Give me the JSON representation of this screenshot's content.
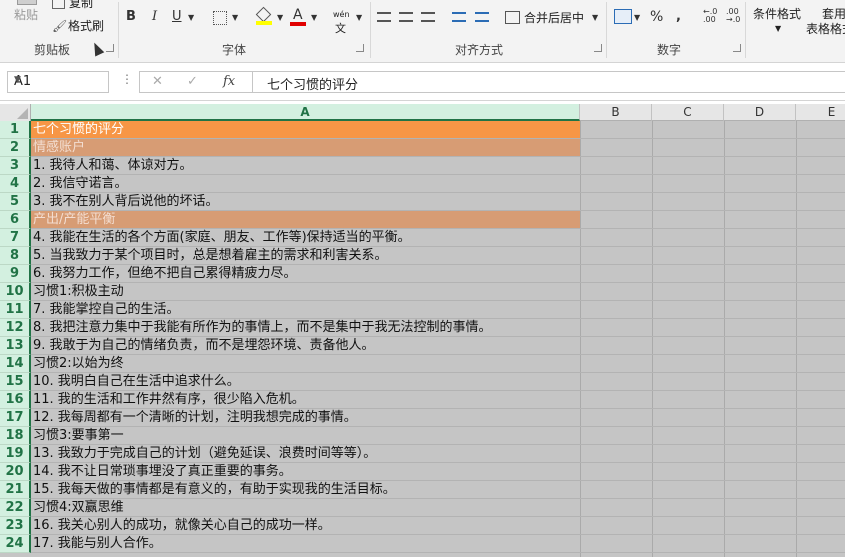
{
  "ribbon": {
    "clipboard": {
      "paste_label": "粘贴",
      "copy_label": "复制",
      "format_painter_label": "格式刷",
      "group_label": "剪贴板"
    },
    "font": {
      "bold": "B",
      "italic": "I",
      "underline": "U",
      "font_color_glyph": "A",
      "wen_glyph": "wén",
      "group_label": "字体"
    },
    "alignment": {
      "merge_center_label": "合并后居中",
      "group_label": "对齐方式"
    },
    "number": {
      "percent": "%",
      "comma": ",",
      "group_label": "数字"
    },
    "styles": {
      "conditional_format_label": "条件格式",
      "table_format_label_1": "套用",
      "table_format_label_2": "表格格式"
    }
  },
  "formula_bar": {
    "name_box": "A1",
    "cancel_glyph": "✕",
    "enter_glyph": "✓",
    "fx_glyph": "fx",
    "content": "七个习惯的评分"
  },
  "columns": [
    "A",
    "B",
    "C",
    "D",
    "E"
  ],
  "rows": [
    {
      "num": "1",
      "text": "七个习惯的评分",
      "style": "title"
    },
    {
      "num": "2",
      "text": "情感账户",
      "style": "section"
    },
    {
      "num": "3",
      "text": "1. 我待人和蔼、体谅对方。",
      "style": ""
    },
    {
      "num": "4",
      "text": "2. 我信守诺言。",
      "style": ""
    },
    {
      "num": "5",
      "text": "3. 我不在别人背后说他的坏话。",
      "style": ""
    },
    {
      "num": "6",
      "text": "产出/产能平衡",
      "style": "section"
    },
    {
      "num": "7",
      "text": "4. 我能在生活的各个方面(家庭、朋友、工作等)保持适当的平衡。",
      "style": ""
    },
    {
      "num": "8",
      "text": "5. 当我致力于某个项目时，总是想着雇主的需求和利害关系。",
      "style": ""
    },
    {
      "num": "9",
      "text": "6. 我努力工作，但绝不把自己累得精疲力尽。",
      "style": ""
    },
    {
      "num": "10",
      "text": "习惯1:积极主动",
      "style": ""
    },
    {
      "num": "11",
      "text": "7. 我能掌控自己的生活。",
      "style": ""
    },
    {
      "num": "12",
      "text": "8. 我把注意力集中于我能有所作为的事情上，而不是集中于我无法控制的事情。",
      "style": ""
    },
    {
      "num": "13",
      "text": "9. 我敢于为自己的情绪负责，而不是埋怨环境、责备他人。",
      "style": ""
    },
    {
      "num": "14",
      "text": "习惯2:以始为终",
      "style": ""
    },
    {
      "num": "15",
      "text": "10. 我明白自己在生活中追求什么。",
      "style": ""
    },
    {
      "num": "16",
      "text": "11. 我的生活和工作井然有序，很少陷入危机。",
      "style": ""
    },
    {
      "num": "17",
      "text": "12. 我每周都有一个清晰的计划，注明我想完成的事情。",
      "style": ""
    },
    {
      "num": "18",
      "text": "习惯3:要事第一",
      "style": ""
    },
    {
      "num": "19",
      "text": "13. 我致力于完成自己的计划（避免延误、浪费时间等等）。",
      "style": ""
    },
    {
      "num": "20",
      "text": "14. 我不让日常琐事埋没了真正重要的事务。",
      "style": ""
    },
    {
      "num": "21",
      "text": "15. 我每天做的事情都是有意义的，有助于实现我的生活目标。",
      "style": ""
    },
    {
      "num": "22",
      "text": "习惯4:双赢思维",
      "style": ""
    },
    {
      "num": "23",
      "text": "16. 我关心别人的成功，就像关心自己的成功一样。",
      "style": ""
    },
    {
      "num": "24",
      "text": "17. 我能与别人合作。",
      "style": ""
    }
  ],
  "colors": {
    "title_fill": "#f79646",
    "section_fill": "#d79c74",
    "selection_shade": "#c5c5c5",
    "header_selected": "#217346"
  }
}
